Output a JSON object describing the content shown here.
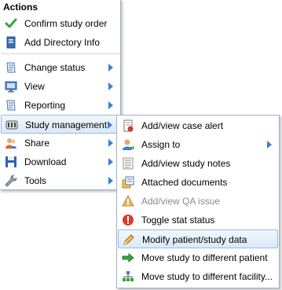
{
  "main_menu": {
    "header": "Actions",
    "items": [
      {
        "label": "Confirm study order",
        "icon": "checkmark-icon"
      },
      {
        "label": "Add Directory Info",
        "icon": "directory-book-icon"
      },
      {
        "label": "Change status",
        "icon": "status-document-icon"
      },
      {
        "label": "View",
        "icon": "monitor-icon"
      },
      {
        "label": "Reporting",
        "icon": "report-document-icon"
      },
      {
        "label": "Study management",
        "icon": "study-management-icon"
      },
      {
        "label": "Share",
        "icon": "share-users-icon"
      },
      {
        "label": "Download",
        "icon": "floppy-disk-icon"
      },
      {
        "label": "Tools",
        "icon": "wrench-icon"
      }
    ]
  },
  "sub_menu": {
    "items": [
      {
        "label": "Add/view case alert",
        "icon": "case-alert-icon"
      },
      {
        "label": "Assign to",
        "icon": "assign-user-icon"
      },
      {
        "label": "Add/view study notes",
        "icon": "notes-icon"
      },
      {
        "label": "Attached documents",
        "icon": "attached-documents-icon"
      },
      {
        "label": "Add/view QA issue",
        "icon": "qa-warning-icon"
      },
      {
        "label": "Toggle stat status",
        "icon": "stat-alert-icon"
      },
      {
        "label": "Modify patient/study data",
        "icon": "pencil-icon"
      },
      {
        "label": "Move study to different patient",
        "icon": "green-arrow-icon"
      },
      {
        "label": "Move study to different facility...",
        "icon": "facility-tree-icon"
      }
    ]
  },
  "colors": {
    "accent": "#3b7fd6",
    "highlight_border": "#9cb9e0",
    "menu_border": "#9fb2c8"
  }
}
